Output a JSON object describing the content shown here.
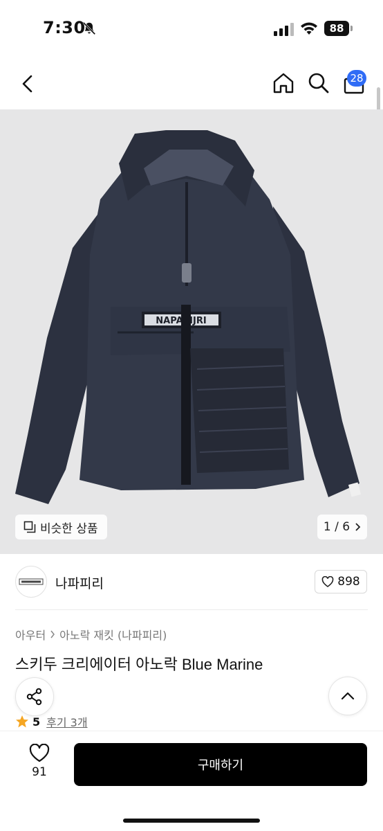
{
  "status_bar": {
    "time": "7:30",
    "battery": "88"
  },
  "nav": {
    "cart_badge": "28"
  },
  "image": {
    "similar_label": "비슷한 상품",
    "counter": "1 / 6",
    "brand_patch": "NAPAPIJRI"
  },
  "seller": {
    "name": "나파피리",
    "like_count": "898"
  },
  "breadcrumb": {
    "category": "아우터",
    "subcategory": "아노락 재킷 (나파피리)"
  },
  "product": {
    "title": "스키두 크리에이터 아노락 Blue Marine"
  },
  "rating": {
    "value": "5",
    "reviews_label": "후기 3개"
  },
  "bottom": {
    "wish_count": "91",
    "buy_label": "구매하기"
  },
  "colors": {
    "accent": "#2f6cf6",
    "buy_button": "#000000",
    "jacket": "#2c3140",
    "star": "#f5a623"
  },
  "icons": [
    "bell-slash-icon",
    "signal-icon",
    "wifi-icon",
    "back-arrow-icon",
    "home-icon",
    "search-icon",
    "shopping-bag-icon",
    "similar-items-icon",
    "chevron-right-icon",
    "heart-icon",
    "share-icon",
    "chevron-up-icon",
    "star-icon"
  ]
}
